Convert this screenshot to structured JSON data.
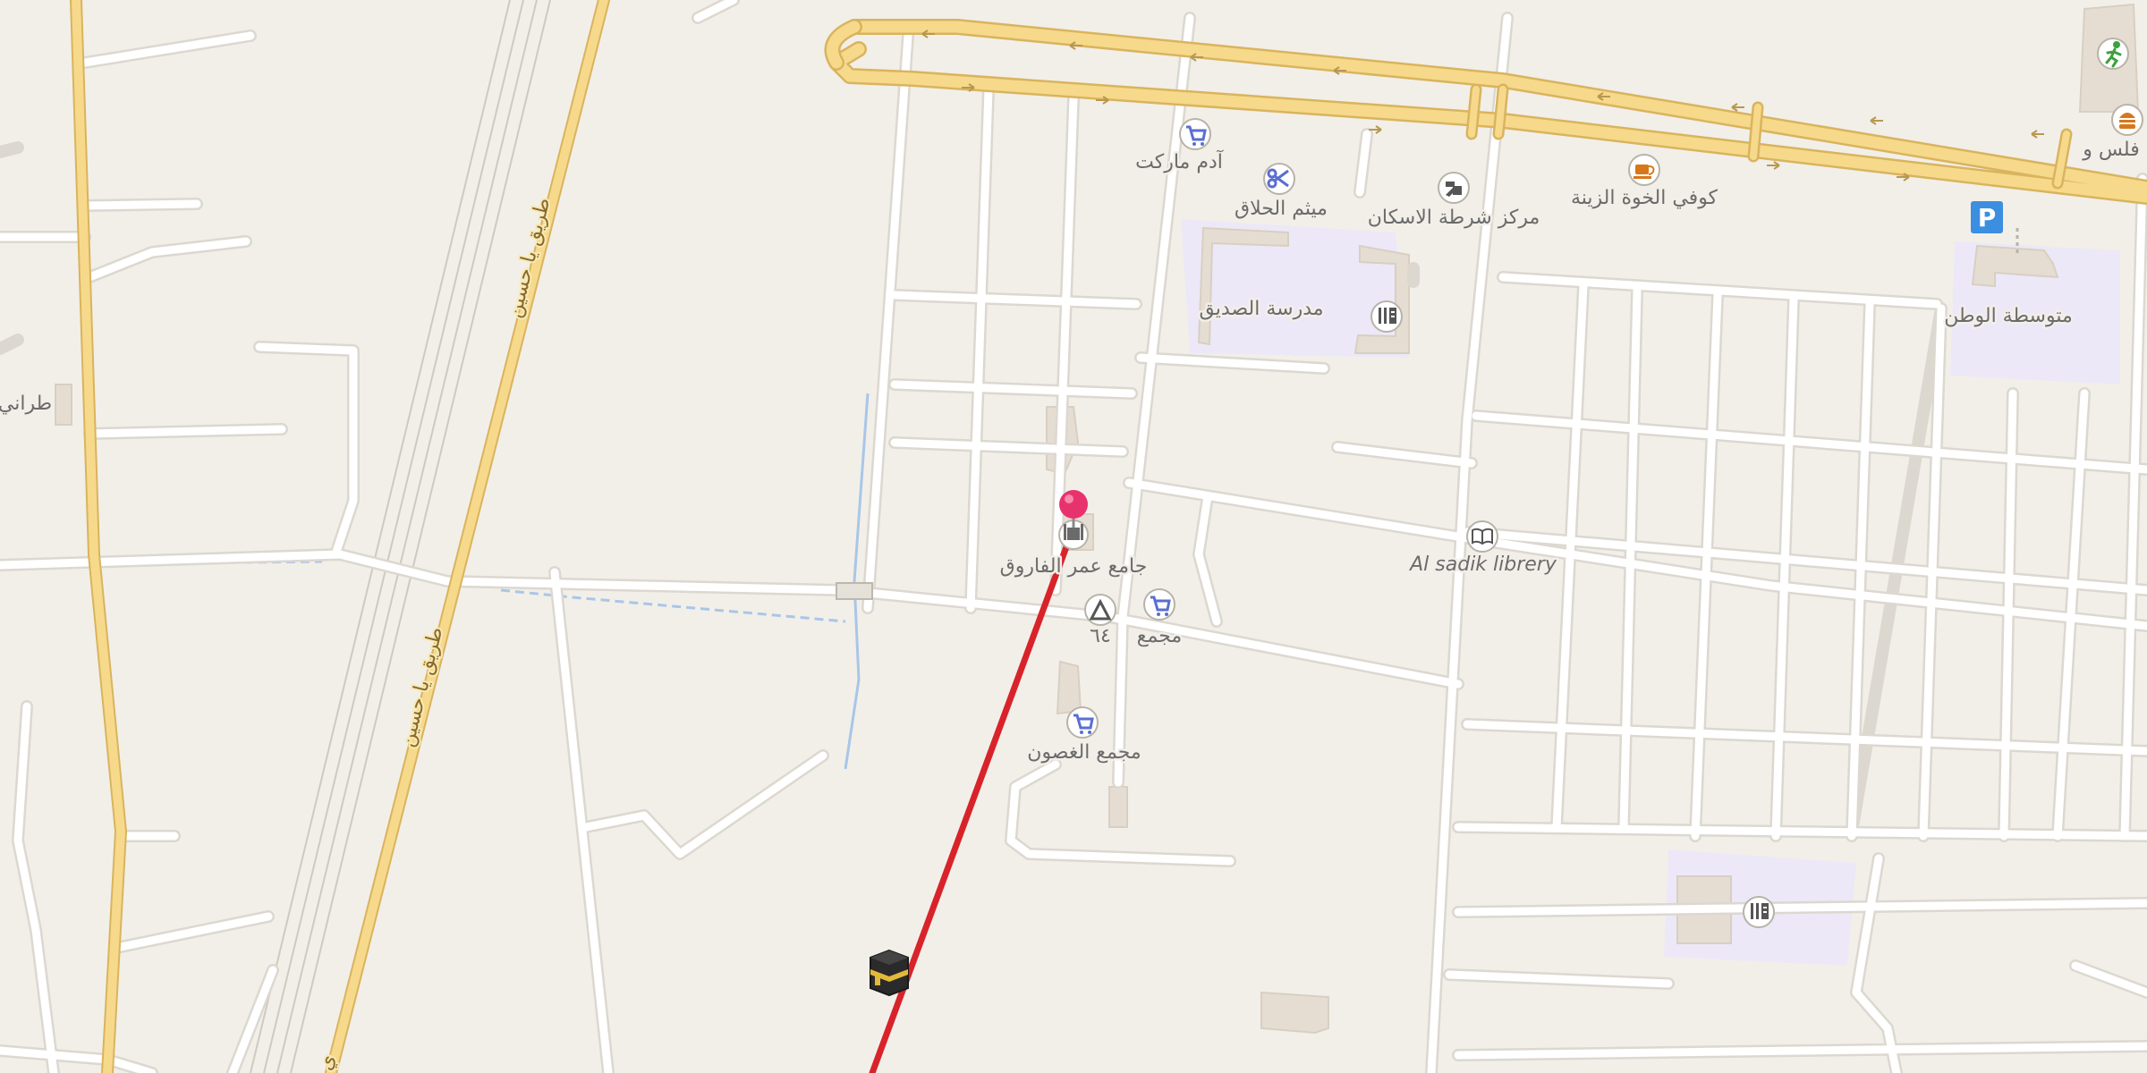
{
  "map": {
    "labels": {
      "mosque": "جامع عمر الفاروق",
      "library": "Al sadik librery",
      "school_sadiq": "مدرسة الصديق",
      "school_watan": "متوسطة الوطن",
      "adam_market": "آدم ماركت",
      "barber": "ميثم الحلاق",
      "police": "مركز شرطة الاسكان",
      "cafe": "كوفي الخوة الزينة",
      "shop_1": "مجمع",
      "shop_ghosoon": "مجمع الغصون",
      "peak_ref": "٦٤",
      "left_edge": "طراني",
      "right_edge_top": "فلس و",
      "road_1": "طريق يا حسين",
      "road_2": "طريق يا حسين",
      "road_3": "ي"
    },
    "icons": {
      "location_pin": "location-pin-icon",
      "kaaba": "kaaba-icon",
      "mosque": "mosque-icon",
      "library": "book-icon",
      "shop": "shopping-cart-icon",
      "barber": "scissors-icon",
      "police": "police-icon",
      "cafe": "coffee-cup-icon",
      "school": "school-icon",
      "parking": "parking-icon",
      "peak": "peak-triangle-icon",
      "sport": "running-person-icon",
      "fastfood": "burger-icon"
    },
    "parking_letter": "P",
    "colors": {
      "background": "#f2efe9",
      "major_road": "#f7d98b",
      "major_road_casing": "#d9b45e",
      "minor_road": "#ffffff",
      "minor_road_casing": "#dcd8d0",
      "school_area": "#ece8f7",
      "qibla_line": "#d8232a",
      "pin": "#e8326e",
      "parking": "#3b8ee0",
      "shop_icon": "#5a6fd1",
      "cafe_icon": "#d8771a",
      "water": "#a9c6e8"
    }
  }
}
